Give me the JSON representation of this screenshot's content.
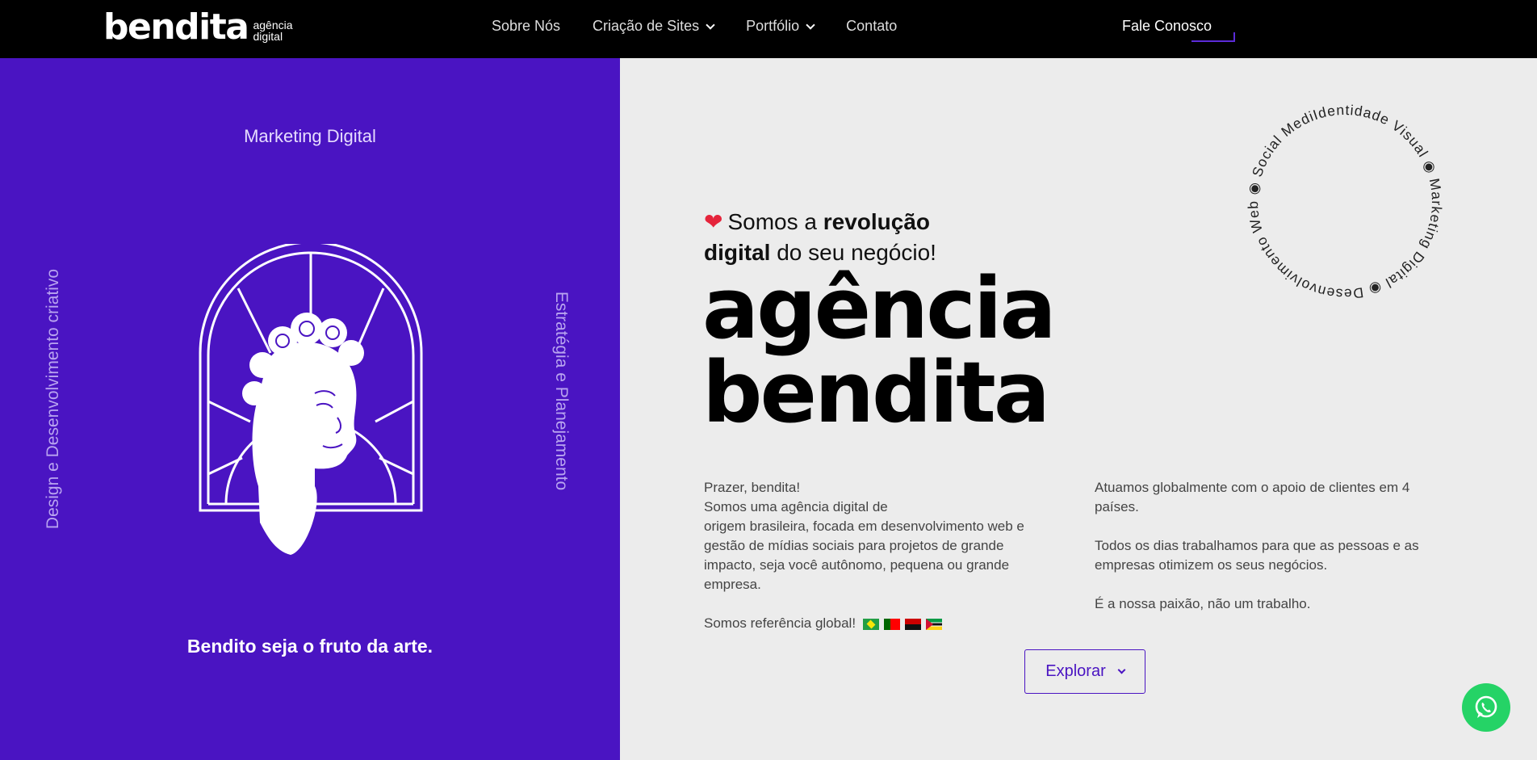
{
  "header": {
    "logo_word": "bendita",
    "logo_sub_line1": "agência",
    "logo_sub_line2": "digital",
    "nav": [
      {
        "label": "Sobre Nós",
        "has_dropdown": false
      },
      {
        "label": "Criação de Sites",
        "has_dropdown": true
      },
      {
        "label": "Portfólio",
        "has_dropdown": true
      },
      {
        "label": "Contato",
        "has_dropdown": false
      }
    ],
    "cta_label": "Fale Conosco"
  },
  "left_panel": {
    "top_label": "Marketing Digital",
    "vertical_left": "Design e Desenvolvimento criativo",
    "vertical_right": "Estratégia e Planejamento",
    "tagline": "Bendito seja o fruto da arte."
  },
  "hero": {
    "intro_part1": "Somos a ",
    "intro_bold1": "revolução",
    "intro_bold2": "digital",
    "intro_part2": " do seu negócio!",
    "headline_line1": "agência",
    "headline_line2": "bendita"
  },
  "about": {
    "left_p1": "Prazer, bendita!\nSomos uma agência digital de\norigem brasileira, focada em desenvolvimento web e gestão de mídias sociais para projetos de grande impacto, seja você autônomo, pequena ou grande empresa.",
    "left_p2": "Somos referência global!",
    "right_p1": "Atuamos globalmente com o apoio de clientes em 4 países.",
    "right_p2": "Todos os dias trabalhamos para que as pessoas e as empresas otimizem os seus negócios.",
    "right_p3": "É a nossa paixão, não um trabalho."
  },
  "explore_label": "Explorar",
  "ring_text": "Identidade Visual ◉ Marketing Digital ◉ Desenvolvimento Web ◉ Social Media ◉ ",
  "colors": {
    "purple": "#4a14c2",
    "black": "#000000",
    "light_bg": "#ececec",
    "whatsapp": "#25d366"
  },
  "icons": [
    "heart-icon",
    "chevron-down-icon",
    "whatsapp-icon",
    "flag-brazil-icon",
    "flag-portugal-icon",
    "flag-angola-icon",
    "flag-mozambique-icon"
  ]
}
